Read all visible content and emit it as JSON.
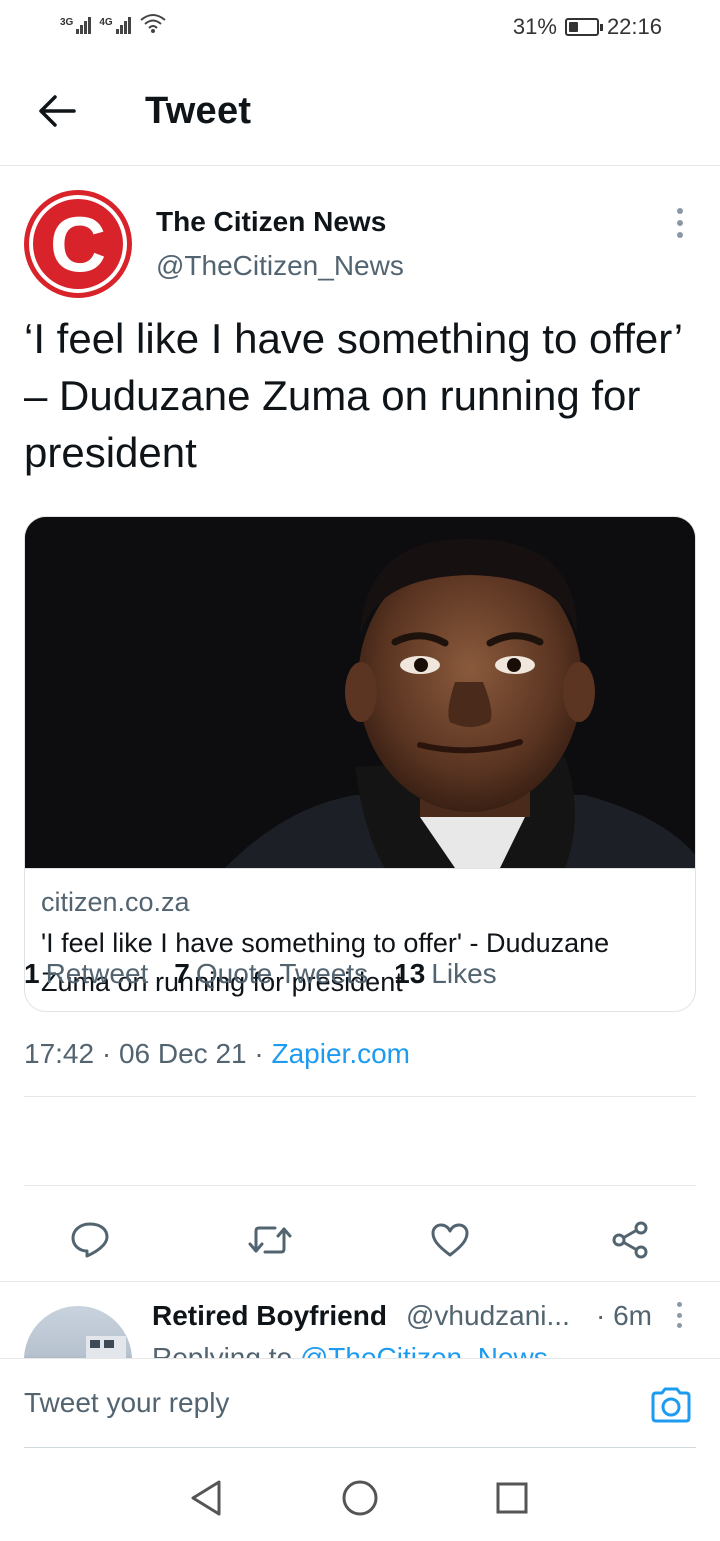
{
  "status_bar": {
    "signal_1_label": "3G",
    "signal_2_label": "4G",
    "battery_percent": "31%",
    "battery_level": 0.31,
    "time": "22:16"
  },
  "header": {
    "back_icon": "arrow-left-icon",
    "title": "Tweet"
  },
  "tweet": {
    "author": {
      "avatar_letter": "C",
      "name": "The Citizen News",
      "handle": "@TheCitizen_News"
    },
    "text": "‘I feel like I have something to offer’ – Duduzane Zuma on running for president",
    "card": {
      "domain": "citizen.co.za",
      "title": "'I feel like I have something to offer' - Duduzane Zuma on running for president"
    },
    "time": "17:42",
    "date": "06 Dec 21",
    "source": "Zapier.com",
    "stats": {
      "retweets_count": "1",
      "retweets_label": "Retweet",
      "quotes_count": "7",
      "quotes_label": "Quote Tweets",
      "likes_count": "13",
      "likes_label": "Likes"
    }
  },
  "reply_preview": {
    "name": "Retired Boyfriend",
    "handle": "@vhudzani...",
    "time": "· 6m",
    "replying_prefix": "Replying to",
    "replying_mention": "@TheCitizen_News"
  },
  "compose": {
    "placeholder": "Tweet your reply"
  },
  "colors": {
    "accent": "#1d9bf0",
    "text": "#0f1419",
    "secondary_text": "#536471",
    "brand_red": "#d8232a"
  }
}
